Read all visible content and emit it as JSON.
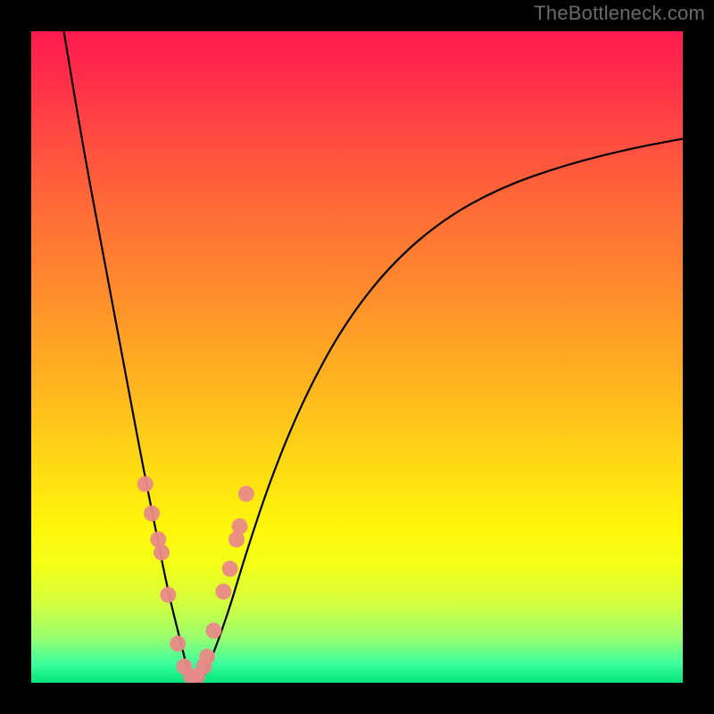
{
  "watermark": "TheBottleneck.com",
  "chart_data": {
    "type": "line",
    "title": "",
    "xlabel": "",
    "ylabel": "",
    "xlim": [
      0,
      100
    ],
    "ylim": [
      0,
      100
    ],
    "series": [
      {
        "name": "bottleneck-curve",
        "x": [
          5,
          8,
          11,
          14,
          17,
          19,
          21,
          23,
          24,
          25,
          26,
          27,
          30,
          33,
          37,
          42,
          48,
          55,
          63,
          72,
          82,
          92,
          100
        ],
        "values": [
          100,
          82,
          66,
          50,
          34,
          24,
          14,
          6,
          2,
          0,
          0,
          2,
          10,
          20,
          32,
          44,
          55,
          64,
          71,
          76,
          79.5,
          82,
          83.5
        ]
      }
    ],
    "markers": {
      "name": "highlighted-points",
      "color": "#e98a88",
      "x": [
        17.5,
        18.5,
        19.5,
        20.0,
        21.0,
        22.5,
        23.5,
        24.5,
        25.5,
        26.5,
        27.0,
        28.0,
        29.5,
        30.5,
        31.5,
        32.0,
        33.0
      ],
      "values": [
        30.5,
        26.0,
        22.0,
        20.0,
        13.5,
        6.0,
        2.5,
        1.0,
        1.0,
        2.5,
        4.0,
        8.0,
        14.0,
        17.5,
        22.0,
        24.0,
        29.0
      ]
    },
    "gradient_stops": [
      {
        "pos": 0,
        "color": "#ff1a4f"
      },
      {
        "pos": 14,
        "color": "#ff4444"
      },
      {
        "pos": 40,
        "color": "#ff8c2d"
      },
      {
        "pos": 66,
        "color": "#ffd814"
      },
      {
        "pos": 82,
        "color": "#f4ff18"
      },
      {
        "pos": 100,
        "color": "#00e37a"
      }
    ]
  }
}
